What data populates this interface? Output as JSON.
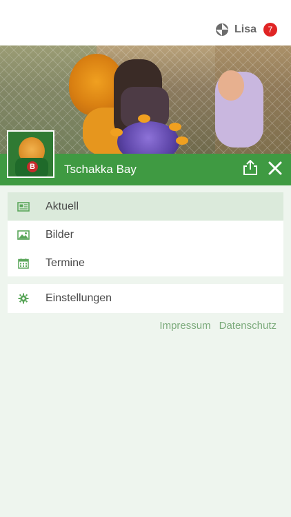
{
  "header": {
    "user_name": "Lisa",
    "notification_count": "7"
  },
  "venue": {
    "title": "Tschakka Bay"
  },
  "menu": {
    "primary": [
      {
        "label": "Aktuell",
        "icon": "newspaper-icon",
        "active": true
      },
      {
        "label": "Bilder",
        "icon": "image-icon",
        "active": false
      },
      {
        "label": "Termine",
        "icon": "calendar-icon",
        "active": false
      }
    ],
    "secondary": [
      {
        "label": "Einstellungen",
        "icon": "gear-icon",
        "active": false
      }
    ]
  },
  "footer": {
    "impressum": "Impressum",
    "datenschutz": "Datenschutz"
  },
  "colors": {
    "brand_green": "#3f9a42",
    "icon_green": "#5aa65a",
    "active_bg": "#dbeadb",
    "page_bg": "#eef5ee",
    "badge_red": "#e02424"
  }
}
